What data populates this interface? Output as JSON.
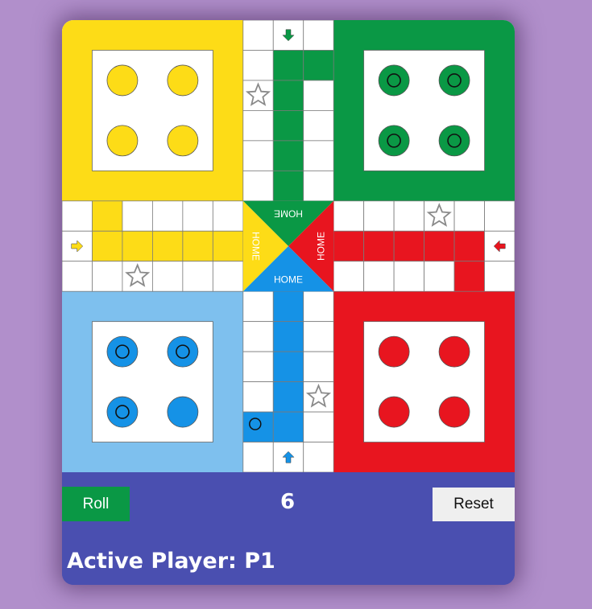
{
  "colors": {
    "yellow": "#fddc17",
    "green": "#0a9845",
    "red": "#e8151f",
    "blue": "#1592e6",
    "light_blue": "#7ec0ee",
    "panel": "#4a4fb0",
    "background": "#b18fcb"
  },
  "board": {
    "home_labels": {
      "top": "HOME",
      "left": "HOME",
      "right": "HOME",
      "bottom": "HOME"
    },
    "yards": {
      "yellow": {
        "tokens": 4,
        "ringed": [
          false,
          false,
          false,
          false
        ]
      },
      "green": {
        "tokens": 4,
        "ringed": [
          true,
          true,
          true,
          true
        ]
      },
      "blue": {
        "tokens": 4,
        "ringed": [
          true,
          true,
          true,
          false
        ]
      },
      "red": {
        "tokens": 4,
        "ringed": [
          false,
          false,
          false,
          false
        ]
      }
    },
    "tokens_on_track": [
      {
        "color": "blue",
        "ringed": true
      }
    ],
    "safe_star_icons": 4,
    "entry_arrows": [
      "down-arrow-icon",
      "right-arrow-icon",
      "left-arrow-icon",
      "up-arrow-icon"
    ]
  },
  "controls": {
    "roll_label": "Roll",
    "dice_value": "6",
    "reset_label": "Reset",
    "active_player": "Active Player: P1"
  }
}
